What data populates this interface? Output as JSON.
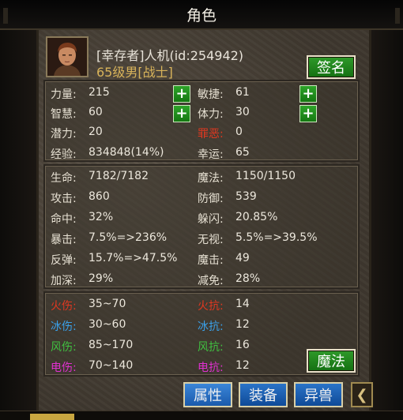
{
  "window": {
    "title": "角色"
  },
  "profile": {
    "name_line": "[幸存者]人机(id:254942)",
    "level_line": "65级男[战士]",
    "sign_button": "签名"
  },
  "base_stats": [
    {
      "label": "力量:",
      "value": "215",
      "has_plus": true
    },
    {
      "label": "敏捷:",
      "value": "61",
      "has_plus": true
    },
    {
      "label": "智慧:",
      "value": "60",
      "has_plus": true
    },
    {
      "label": "体力:",
      "value": "30",
      "has_plus": true
    },
    {
      "label": "潜力:",
      "value": "20",
      "has_plus": false
    },
    {
      "label": "罪恶:",
      "value": "0",
      "has_plus": false
    },
    {
      "label": "经验:",
      "value": "834848(14%)",
      "has_plus": false
    },
    {
      "label": "幸运:",
      "value": "65",
      "has_plus": false
    }
  ],
  "plus_symbol": "+",
  "combat_stats": [
    {
      "label": "生命:",
      "value": "7182/7182"
    },
    {
      "label": "魔法:",
      "value": "1150/1150"
    },
    {
      "label": "攻击:",
      "value": "860"
    },
    {
      "label": "防御:",
      "value": "539"
    },
    {
      "label": "命中:",
      "value": "32%"
    },
    {
      "label": "躲闪:",
      "value": "20.85%"
    },
    {
      "label": "暴击:",
      "value": "7.5%=>236%"
    },
    {
      "label": "无视:",
      "value": "5.5%=>39.5%"
    },
    {
      "label": "反弹:",
      "value": "15.7%=>47.5%"
    },
    {
      "label": "魔击:",
      "value": "49"
    },
    {
      "label": "加深:",
      "value": "29%"
    },
    {
      "label": "减免:",
      "value": "28%"
    }
  ],
  "element_stats": [
    {
      "label": "火伤:",
      "value": "35~70",
      "color": "#e03820"
    },
    {
      "label": "火抗:",
      "value": "14",
      "color": "#e03820"
    },
    {
      "label": "冰伤:",
      "value": "30~60",
      "color": "#3aa0e8"
    },
    {
      "label": "冰抗:",
      "value": "12",
      "color": "#3aa0e8"
    },
    {
      "label": "风伤:",
      "value": "85~170",
      "color": "#40c040"
    },
    {
      "label": "风抗:",
      "value": "16",
      "color": "#40c040"
    },
    {
      "label": "电伤:",
      "value": "70~140",
      "color": "#e030d0"
    },
    {
      "label": "电抗:",
      "value": "12",
      "color": "#e030d0"
    }
  ],
  "magic_button": "魔法",
  "tabs": [
    {
      "label": "属性",
      "active": true
    },
    {
      "label": "装备",
      "active": false
    },
    {
      "label": "异兽",
      "active": false
    }
  ],
  "back_icon": "chevron-left-icon",
  "colors": {
    "sin_label": "#e03820",
    "level_text": "#d8b35a",
    "green_button": "#1f8a1c",
    "tab_blue": "#1a5aac"
  }
}
